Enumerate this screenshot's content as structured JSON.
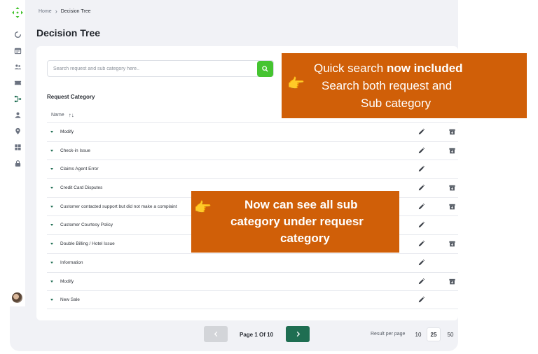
{
  "breadcrumb": {
    "home": "Home",
    "current": "Decision Tree"
  },
  "page": {
    "title": "Decision Tree"
  },
  "search": {
    "placeholder": "Search request and sub category here.."
  },
  "table": {
    "section_title": "Request Category",
    "column_name": "Name",
    "rows": [
      {
        "label": "Modify",
        "has_archive": true
      },
      {
        "label": "Check-in Issue",
        "has_archive": true
      },
      {
        "label": "Claims Agent Error",
        "has_archive": false
      },
      {
        "label": "Credit Card Disputes",
        "has_archive": true
      },
      {
        "label": "Customer contacted support but did not make a complaint",
        "has_archive": true
      },
      {
        "label": "Customer Courtesy Policy",
        "has_archive": false
      },
      {
        "label": "Double Billing / Hotel Issue",
        "has_archive": true
      },
      {
        "label": "Information",
        "has_archive": false
      },
      {
        "label": "Modify",
        "has_archive": true
      },
      {
        "label": "New Sale",
        "has_archive": false
      }
    ]
  },
  "pagination": {
    "text": "Page 1 Of 10"
  },
  "results_per_page": {
    "label": "Result per page",
    "options": [
      "10",
      "25",
      "50"
    ],
    "selected": "25"
  },
  "callouts": {
    "search": {
      "line1_normal": "Quick search ",
      "line1_bold": "now included",
      "line2": "Search both request and",
      "line3": "Sub category"
    },
    "subcategory": {
      "line1": "Now can see all sub",
      "line2": "category under requesr",
      "line3": "category"
    }
  },
  "colors": {
    "accent_green": "#45c430",
    "primary_dark_green": "#1f6e52",
    "callout_orange": "#d05f08"
  },
  "icons": {
    "sidebar": [
      "dashboard-icon",
      "calendar-icon",
      "users-icon",
      "ticket-icon",
      "decision-tree-icon",
      "user-icon",
      "location-icon",
      "grid-icon",
      "lock-icon"
    ],
    "row_actions": [
      "edit-icon",
      "archive-icon"
    ]
  }
}
